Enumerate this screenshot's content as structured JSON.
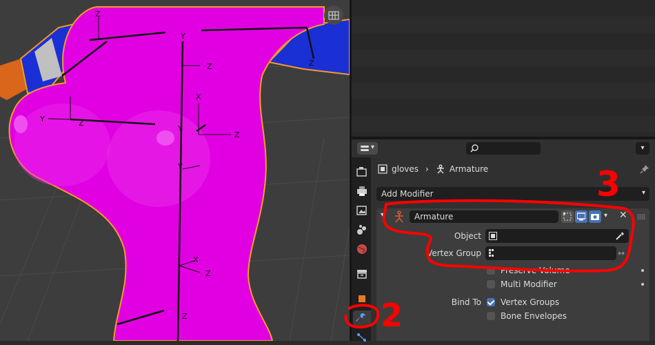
{
  "viewport": {
    "armature_labels": [
      "X",
      "Y",
      "Z"
    ]
  },
  "properties": {
    "breadcrumb": {
      "object": "gloves",
      "separator": "›",
      "armature": "Armature"
    },
    "add_modifier": {
      "label": "Add Modifier"
    },
    "modifier": {
      "name": "Armature",
      "object_label": "Object",
      "vertex_group_label": "Vertex Group",
      "preserve_volume_label": "Preserve Volume",
      "multi_modifier_label": "Multi Modifier",
      "bind_to_label": "Bind To",
      "vertex_groups_label": "Vertex Groups",
      "bone_envelopes_label": "Bone Envelopes",
      "preserve_volume": false,
      "multi_modifier": false,
      "vertex_groups": true,
      "bone_envelopes": false
    },
    "tabs": [
      "tool",
      "render",
      "output",
      "view-layer",
      "scene",
      "world",
      "collection",
      "object",
      "modifiers",
      "particles"
    ],
    "active_tab": "modifiers"
  },
  "annotations": {
    "step2": "2",
    "step3": "3"
  },
  "colors": {
    "selection_accent": "#4772b3",
    "annotation_red": "#ff0000",
    "mesh_magenta": "#e100e1"
  }
}
